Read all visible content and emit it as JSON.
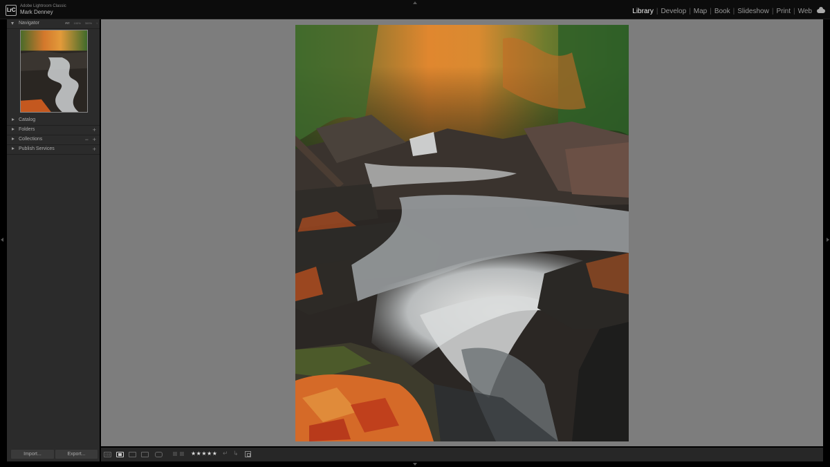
{
  "identity": {
    "logo": "LrC",
    "app_name": "Adobe Lightroom Classic",
    "user": "Mark Denney"
  },
  "modules": [
    {
      "label": "Library",
      "active": true
    },
    {
      "label": "Develop"
    },
    {
      "label": "Map"
    },
    {
      "label": "Book"
    },
    {
      "label": "Slideshow"
    },
    {
      "label": "Print"
    },
    {
      "label": "Web"
    }
  ],
  "left_panel": {
    "navigator": {
      "title": "Navigator",
      "options": [
        "FIT",
        "100%",
        "300%",
        "↕"
      ],
      "active_option": "FIT"
    },
    "sections": [
      {
        "label": "Catalog"
      },
      {
        "label": "Folders",
        "actions": [
          "+"
        ]
      },
      {
        "label": "Collections",
        "actions": [
          "−",
          "+"
        ]
      },
      {
        "label": "Publish Services",
        "actions": [
          "+"
        ]
      }
    ],
    "import_label": "Import...",
    "export_label": "Export..."
  },
  "toolbar": {
    "stars": "★★★★★",
    "rotate_left": "↵",
    "rotate_right": "↳"
  },
  "colors": {
    "active_module": "#f2f2f2",
    "inactive_module": "#999999",
    "panel_bg": "#2b2b2b",
    "view_bg": "#7d7d7d"
  }
}
